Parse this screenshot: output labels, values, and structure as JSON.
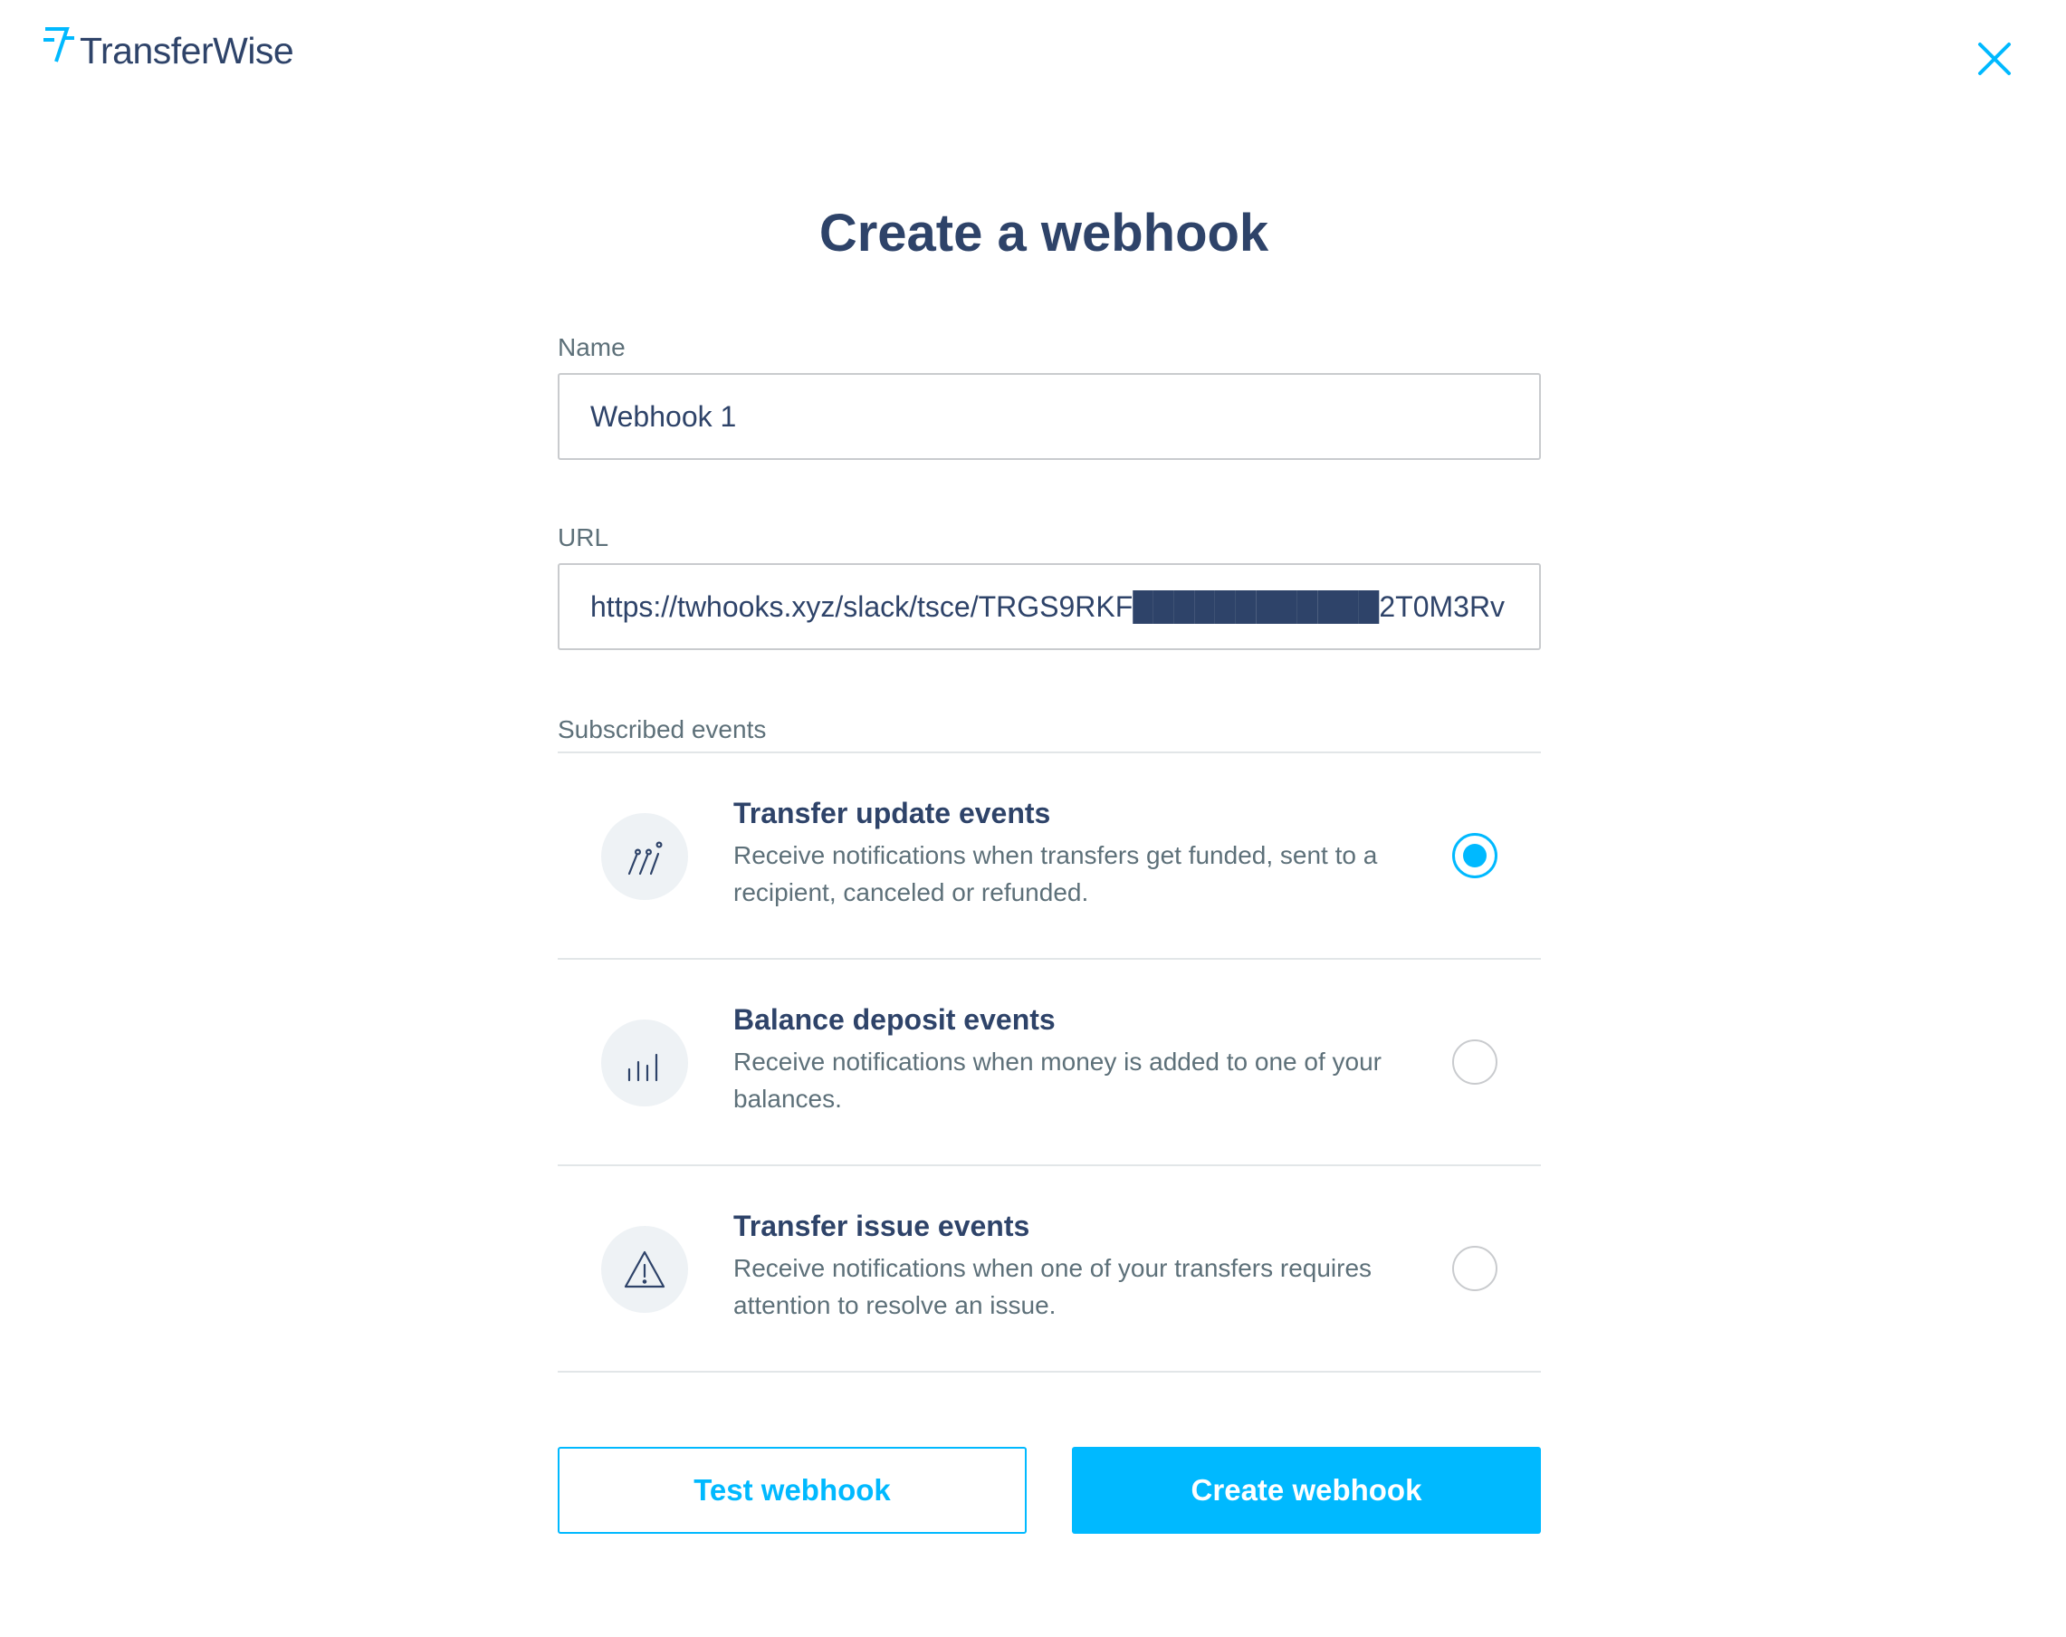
{
  "brand": {
    "name": "TransferWise",
    "accent_color": "#00b9ff",
    "text_color": "#2e4369"
  },
  "header": {
    "logo_icon": "transferwise-flag-icon",
    "close_icon": "close-icon"
  },
  "page_title": "Create a webhook",
  "form": {
    "name_label": "Name",
    "name_value": "Webhook 1",
    "url_label": "URL",
    "url_value": "https://twhooks.xyz/slack/tsce/TRGS9RKF████████████2T0M3Rv",
    "events_label": "Subscribed events"
  },
  "events": [
    {
      "title": "Transfer update events",
      "description": "Receive notifications when transfers get funded, sent to a recipient, canceled or refunded.",
      "icon": "transfer-flow-icon",
      "selected": true
    },
    {
      "title": "Balance deposit events",
      "description": "Receive notifications when money is added to one of your balances.",
      "icon": "bar-chart-icon",
      "selected": false
    },
    {
      "title": "Transfer issue events",
      "description": "Receive notifications when one of your transfers requires attention to resolve an issue.",
      "icon": "warning-triangle-icon",
      "selected": false
    }
  ],
  "actions": {
    "test_label": "Test webhook",
    "create_label": "Create webhook"
  }
}
